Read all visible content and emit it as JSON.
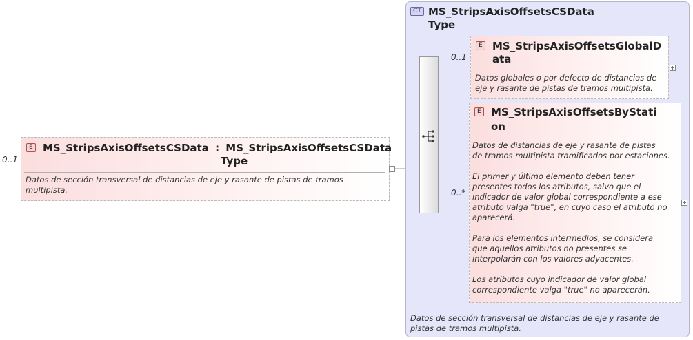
{
  "root_element": {
    "badge": "E",
    "multiplicity": "0..1",
    "name": "MS_StripsAxisOffsetsCSData",
    "separator": ":",
    "type_line1": "MS_StripsAxisOffsetsCSData",
    "type_line2": "Type",
    "doc_line1": "Datos de sección transversal de  distancias de eje y rasante de pistas de tramos",
    "doc_line2": "multipista."
  },
  "complex_type": {
    "badge": "CT",
    "name_line1": "MS_StripsAxisOffsetsCSData",
    "name_line2": "Type",
    "doc_line1": "Datos de sección transversal de distancias de eje y rasante de",
    "doc_line2": "pistas de tramos multipista."
  },
  "children": [
    {
      "badge": "E",
      "multiplicity": "0..1",
      "name_line1": "MS_StripsAxisOffsetsGlobalD",
      "name_line2": "ata",
      "doc": "Datos globales o por defecto de distancias de\neje y rasante de pistas de tramos multipista."
    },
    {
      "badge": "E",
      "multiplicity": "0..*",
      "name_line1": "MS_StripsAxisOffsetsByStati",
      "name_line2": "on",
      "doc": "Datos de distancias de eje y rasante de pistas\nde tramos multipista tramificados por estaciones.\n\nEl primer y último elemento deben tener\npresentes todos los atributos, salvo que el\nindicador de valor global correspondiente a ese\natributo valga \"true\", en cuyo caso el atributo no\naparecerá.\n\nPara los elementos intermedios, se considera\nque aquellos atributos no presentes se\ninterpolarán con los valores adyacentes.\n\nLos atributos cuyo indicador de valor global\ncorrespondiente valga \"true\" no aparecerán."
    }
  ],
  "icons": {
    "sequence": "sequence-compositor-icon",
    "collapse": "collapse-minus-icon",
    "expand": "expand-plus-icon"
  }
}
